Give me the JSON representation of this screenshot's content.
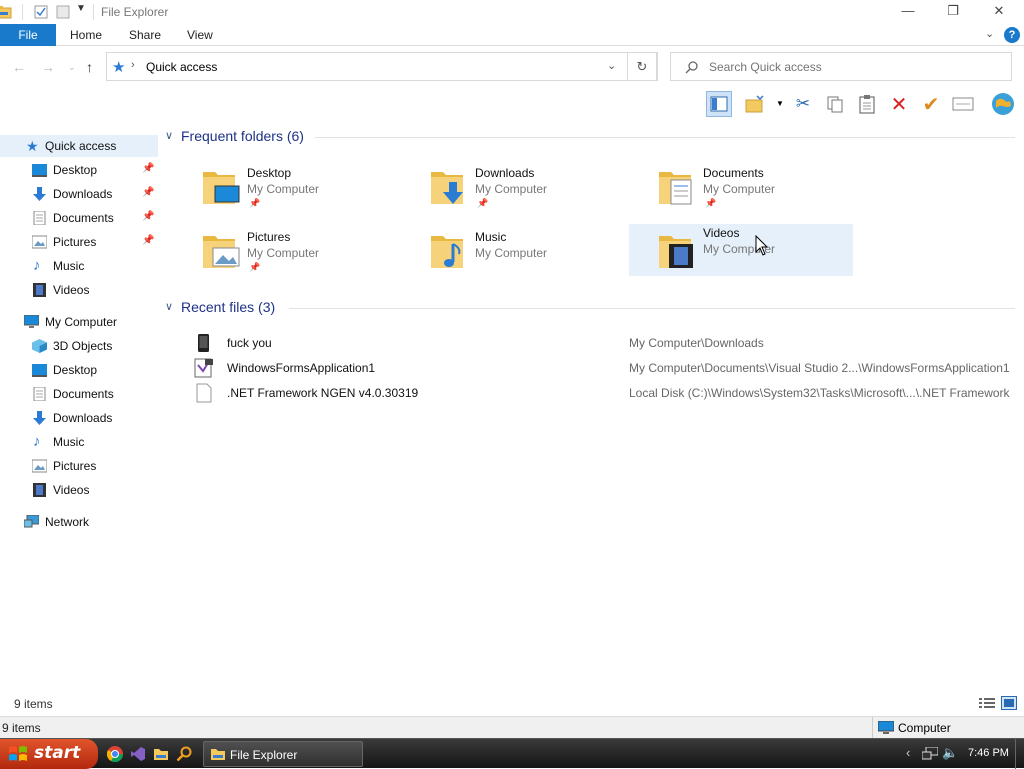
{
  "window": {
    "title": "File Explorer"
  },
  "ribbon": {
    "tabs": [
      "File",
      "Home",
      "Share",
      "View"
    ]
  },
  "address": {
    "path": "Quick access",
    "search_placeholder": "Search Quick access"
  },
  "nav": {
    "quick_access": "Quick access",
    "quick_items": [
      "Desktop",
      "Downloads",
      "Documents",
      "Pictures",
      "Music",
      "Videos"
    ],
    "my_computer": "My Computer",
    "computer_items": [
      "3D Objects",
      "Desktop",
      "Documents",
      "Downloads",
      "Music",
      "Pictures",
      "Videos"
    ],
    "network": "Network"
  },
  "frequent": {
    "header": "Frequent folders (6)",
    "items": [
      {
        "name": "Desktop",
        "location": "My Computer"
      },
      {
        "name": "Downloads",
        "location": "My Computer"
      },
      {
        "name": "Documents",
        "location": "My Computer"
      },
      {
        "name": "Pictures",
        "location": "My Computer"
      },
      {
        "name": "Music",
        "location": "My Computer"
      },
      {
        "name": "Videos",
        "location": "My Computer"
      }
    ]
  },
  "recent": {
    "header": "Recent files (3)",
    "items": [
      {
        "name": "fuck you",
        "path": "My Computer\\Downloads"
      },
      {
        "name": "WindowsFormsApplication1",
        "path": "My Computer\\Documents\\Visual Studio 2...\\WindowsFormsApplication1"
      },
      {
        "name": ".NET Framework NGEN v4.0.30319",
        "path": "Local Disk (C:)\\Windows\\System32\\Tasks\\Microsoft\\...\\.NET Framework"
      }
    ]
  },
  "status": {
    "items_count": "9 items",
    "zone": "Computer"
  },
  "taskbar": {
    "start": "start",
    "task_label": "File Explorer",
    "clock": "7:46 PM"
  },
  "colors": {
    "accent": "#1979ca",
    "folder": "#f4c95d",
    "selection": "#e5f0fb"
  }
}
